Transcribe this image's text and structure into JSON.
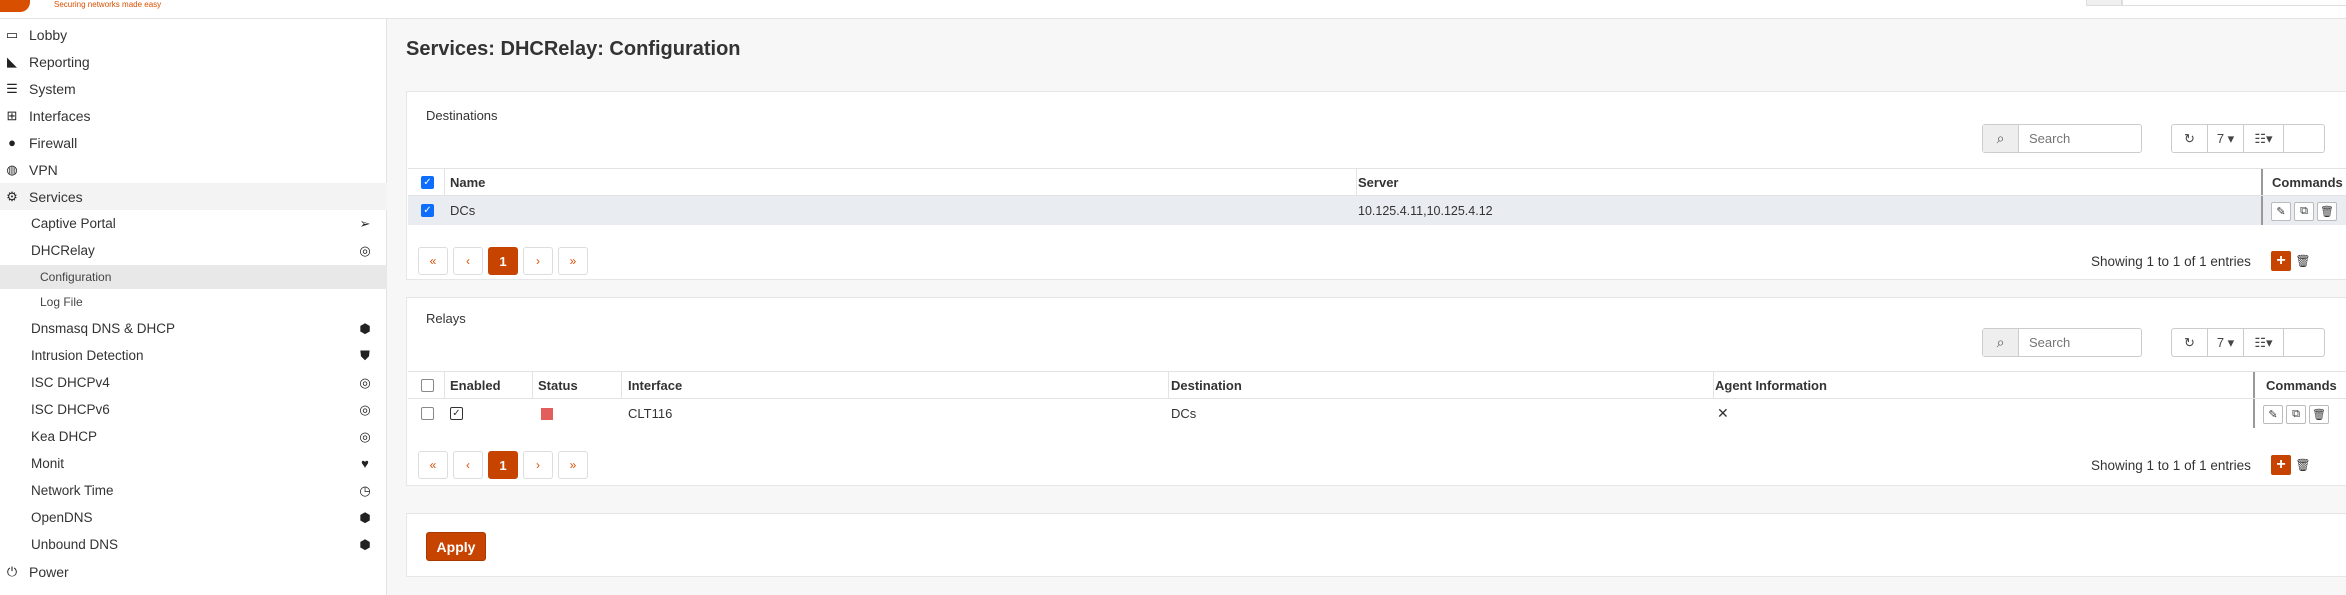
{
  "brand": {
    "tagline": "Securing networks made easy",
    "accent_color": "#c74300"
  },
  "sidebar": {
    "items": [
      {
        "label": "Lobby",
        "icon": "laptop-icon"
      },
      {
        "label": "Reporting",
        "icon": "area-chart-icon"
      },
      {
        "label": "System",
        "icon": "server-icon"
      },
      {
        "label": "Interfaces",
        "icon": "sitemap-icon"
      },
      {
        "label": "Firewall",
        "icon": "fire-icon"
      },
      {
        "label": "VPN",
        "icon": "globe-icon"
      },
      {
        "label": "Services",
        "icon": "gear-icon"
      },
      {
        "label": "Power",
        "icon": "plug-icon"
      }
    ],
    "services_sub": [
      {
        "label": "Captive Portal",
        "icon": "paper-plane-icon"
      },
      {
        "label": "DHCRelay",
        "icon": "bullseye-icon"
      },
      {
        "label": "Dnsmasq DNS & DHCP",
        "icon": "tags-icon"
      },
      {
        "label": "Intrusion Detection",
        "icon": "shield-icon"
      },
      {
        "label": "ISC DHCPv4",
        "icon": "bullseye-icon"
      },
      {
        "label": "ISC DHCPv6",
        "icon": "bullseye-icon"
      },
      {
        "label": "Kea DHCP",
        "icon": "bullseye-icon"
      },
      {
        "label": "Monit",
        "icon": "heartbeat-icon"
      },
      {
        "label": "Network Time",
        "icon": "clock-icon"
      },
      {
        "label": "OpenDNS",
        "icon": "tags-icon"
      },
      {
        "label": "Unbound DNS",
        "icon": "tags-icon"
      }
    ],
    "dhcrelay_sub": [
      {
        "label": "Configuration"
      },
      {
        "label": "Log File"
      }
    ]
  },
  "page": {
    "title": "Services: DHCRelay: Configuration"
  },
  "destinations": {
    "title": "Destinations",
    "search_placeholder": "Search",
    "page_size": "7",
    "columns": {
      "name": "Name",
      "server": "Server",
      "commands": "Commands"
    },
    "rows": [
      {
        "name": "DCs",
        "server": "10.125.4.11,10.125.4.12"
      }
    ],
    "pager": {
      "first": "«",
      "prev": "‹",
      "current": "1",
      "next": "›",
      "last": "»"
    },
    "info": "Showing 1 to 1 of 1 entries"
  },
  "relays": {
    "title": "Relays",
    "search_placeholder": "Search",
    "page_size": "7",
    "columns": {
      "enabled": "Enabled",
      "status": "Status",
      "interface": "Interface",
      "destination": "Destination",
      "agent": "Agent Information",
      "commands": "Commands"
    },
    "rows": [
      {
        "interface": "CLT116",
        "destination": "DCs",
        "agent": "✕",
        "status_color": "#e35d5d"
      }
    ],
    "pager": {
      "first": "«",
      "prev": "‹",
      "current": "1",
      "next": "›",
      "last": "»"
    },
    "info": "Showing 1 to 1 of 1 entries"
  },
  "apply_label": "Apply"
}
